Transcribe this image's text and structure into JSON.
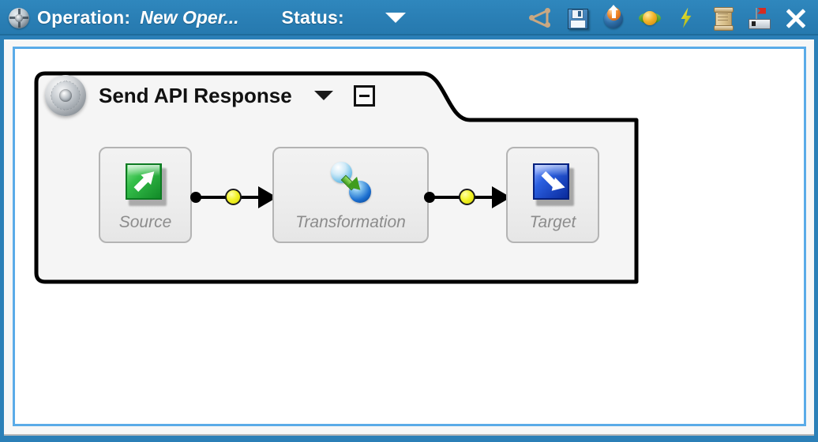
{
  "titlebar": {
    "app_icon": "operation-disc-icon",
    "operation_label": "Operation:",
    "operation_value": "New Oper...",
    "status_label": "Status:",
    "status_value": "",
    "status_caret": "chevron-down-icon",
    "accent_color": "#2b7fb7",
    "text_color": "#ffffff",
    "tools": [
      {
        "name": "graph-icon",
        "title": "Graph"
      },
      {
        "name": "save-icon",
        "title": "Save"
      },
      {
        "name": "deploy-icon",
        "title": "Deploy"
      },
      {
        "name": "refresh-icon",
        "title": "Refresh"
      },
      {
        "name": "run-icon",
        "title": "Run"
      },
      {
        "name": "log-icon",
        "title": "Log"
      },
      {
        "name": "test-icon",
        "title": "Test"
      },
      {
        "name": "close-icon",
        "title": "Close"
      }
    ]
  },
  "canvas": {
    "border_color": "#5aabe8",
    "background": "#ffffff",
    "operation": {
      "icon": "gear-icon",
      "title": "Send API Response",
      "caret": "chevron-down-icon",
      "collapse_label": "−",
      "nodes": [
        {
          "id": "source",
          "label": "Source",
          "icon": "source-green-arrow-icon"
        },
        {
          "id": "transformation",
          "label": "Transformation",
          "icon": "transformation-spheres-icon"
        },
        {
          "id": "target",
          "label": "Target",
          "icon": "target-blue-arrow-icon"
        }
      ],
      "connectors": [
        {
          "from": "source",
          "to": "transformation",
          "marker": "yellow-gem"
        },
        {
          "from": "transformation",
          "to": "target",
          "marker": "yellow-gem"
        }
      ]
    }
  }
}
